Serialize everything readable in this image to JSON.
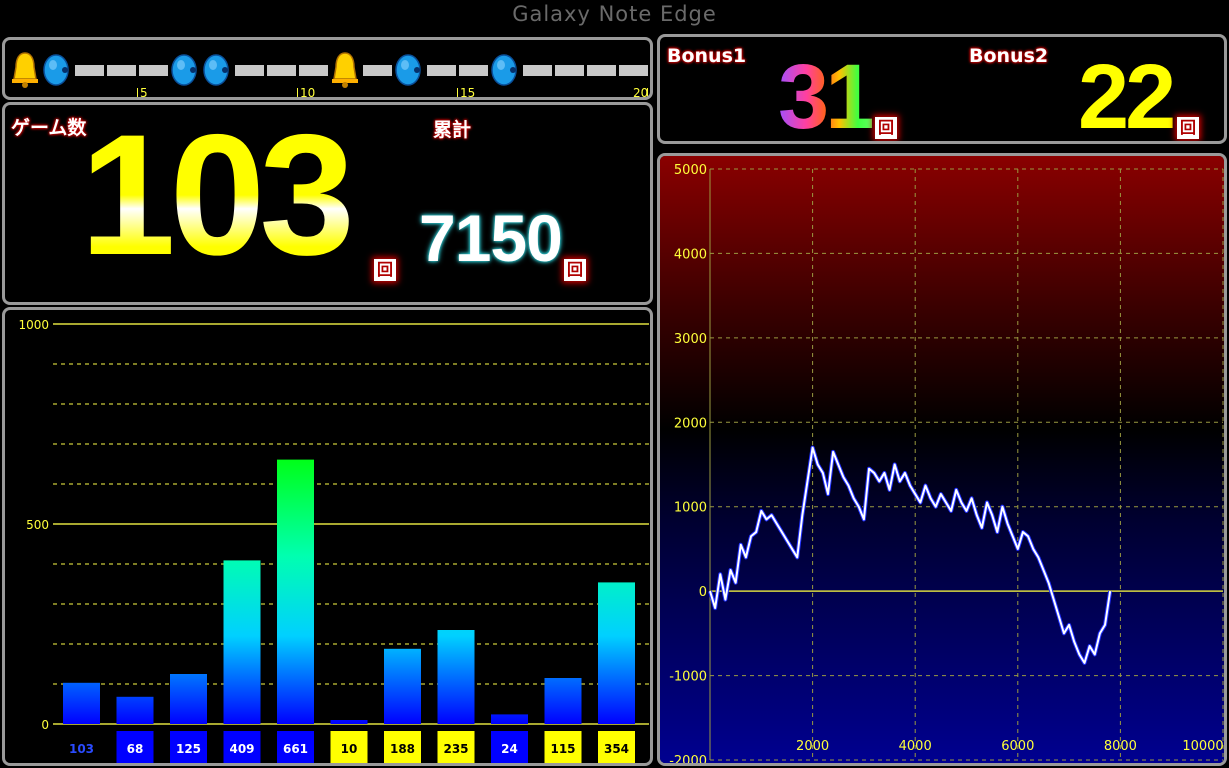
{
  "device": {
    "title": "Galaxy Note Edge"
  },
  "history": {
    "items": [
      "bell-icon",
      "blue-icon",
      "bar",
      "bar",
      "bar",
      "blue-icon",
      "blue-icon",
      "bar",
      "bar",
      "bar",
      "bell-icon",
      "bar",
      "blue-icon",
      "bar",
      "bar",
      "blue-icon",
      "bar",
      "bar",
      "bar",
      "bar"
    ],
    "tick_labels": [
      "5",
      "10",
      "15",
      "20"
    ]
  },
  "game": {
    "label": "ゲーム数",
    "value": "103",
    "unit": "回",
    "total_label": "累計",
    "total_value": "7150",
    "total_unit": "回"
  },
  "bonus": {
    "bonus1_label": "Bonus1",
    "bonus1_value": "31",
    "bonus1_unit": "回",
    "bonus2_label": "Bonus2",
    "bonus2_value": "22",
    "bonus2_unit": "回"
  },
  "colors": {
    "accent_yellow": "#ffff00",
    "bonus1_bar": "#0000ff",
    "bonus2_bar": "#ffff00",
    "grid": "#a8a830",
    "history_bar": "#c8c8c8"
  },
  "chart_data": [
    {
      "type": "bar",
      "ylim": [
        0,
        1000
      ],
      "yticks": [
        0,
        500,
        1000
      ],
      "grid": true,
      "values": [
        103,
        68,
        125,
        409,
        661,
        10,
        188,
        235,
        24,
        115,
        354
      ],
      "label_colors": [
        "blue",
        "blue",
        "blue",
        "blue",
        "blue",
        "yellow",
        "yellow",
        "yellow",
        "blue",
        "yellow",
        "yellow"
      ],
      "labels": [
        "103",
        "68",
        "125",
        "409",
        "661",
        "10",
        "188",
        "235",
        "24",
        "115",
        "354"
      ]
    },
    {
      "type": "line",
      "xlim": [
        0,
        10000
      ],
      "ylim": [
        -2000,
        5000
      ],
      "xticks": [
        2000,
        4000,
        6000,
        8000,
        10000
      ],
      "yticks": [
        -2000,
        -1000,
        0,
        1000,
        2000,
        3000,
        4000,
        5000
      ],
      "grid": true,
      "points": [
        [
          0,
          0
        ],
        [
          100,
          -200
        ],
        [
          200,
          200
        ],
        [
          300,
          -100
        ],
        [
          400,
          250
        ],
        [
          500,
          100
        ],
        [
          600,
          550
        ],
        [
          700,
          400
        ],
        [
          800,
          650
        ],
        [
          900,
          700
        ],
        [
          1000,
          950
        ],
        [
          1100,
          850
        ],
        [
          1200,
          900
        ],
        [
          1300,
          800
        ],
        [
          1400,
          700
        ],
        [
          1500,
          600
        ],
        [
          1600,
          500
        ],
        [
          1700,
          400
        ],
        [
          1800,
          900
        ],
        [
          1900,
          1300
        ],
        [
          2000,
          1700
        ],
        [
          2100,
          1500
        ],
        [
          2200,
          1400
        ],
        [
          2300,
          1150
        ],
        [
          2400,
          1650
        ],
        [
          2500,
          1500
        ],
        [
          2600,
          1350
        ],
        [
          2700,
          1250
        ],
        [
          2800,
          1100
        ],
        [
          2900,
          1000
        ],
        [
          3000,
          850
        ],
        [
          3100,
          1450
        ],
        [
          3200,
          1400
        ],
        [
          3300,
          1300
        ],
        [
          3400,
          1400
        ],
        [
          3500,
          1200
        ],
        [
          3600,
          1500
        ],
        [
          3700,
          1300
        ],
        [
          3800,
          1400
        ],
        [
          3900,
          1250
        ],
        [
          4000,
          1150
        ],
        [
          4100,
          1050
        ],
        [
          4200,
          1250
        ],
        [
          4300,
          1100
        ],
        [
          4400,
          1000
        ],
        [
          4500,
          1150
        ],
        [
          4600,
          1050
        ],
        [
          4700,
          950
        ],
        [
          4800,
          1200
        ],
        [
          4900,
          1050
        ],
        [
          5000,
          950
        ],
        [
          5100,
          1100
        ],
        [
          5200,
          900
        ],
        [
          5300,
          750
        ],
        [
          5400,
          1050
        ],
        [
          5500,
          900
        ],
        [
          5600,
          700
        ],
        [
          5700,
          1000
        ],
        [
          5800,
          800
        ],
        [
          5900,
          650
        ],
        [
          6000,
          500
        ],
        [
          6100,
          700
        ],
        [
          6200,
          650
        ],
        [
          6300,
          500
        ],
        [
          6400,
          400
        ],
        [
          6500,
          250
        ],
        [
          6600,
          100
        ],
        [
          6700,
          -100
        ],
        [
          6800,
          -300
        ],
        [
          6900,
          -500
        ],
        [
          7000,
          -400
        ],
        [
          7100,
          -600
        ],
        [
          7200,
          -750
        ],
        [
          7300,
          -850
        ],
        [
          7400,
          -650
        ],
        [
          7500,
          -750
        ],
        [
          7600,
          -500
        ],
        [
          7700,
          -400
        ],
        [
          7800,
          0
        ]
      ]
    }
  ]
}
